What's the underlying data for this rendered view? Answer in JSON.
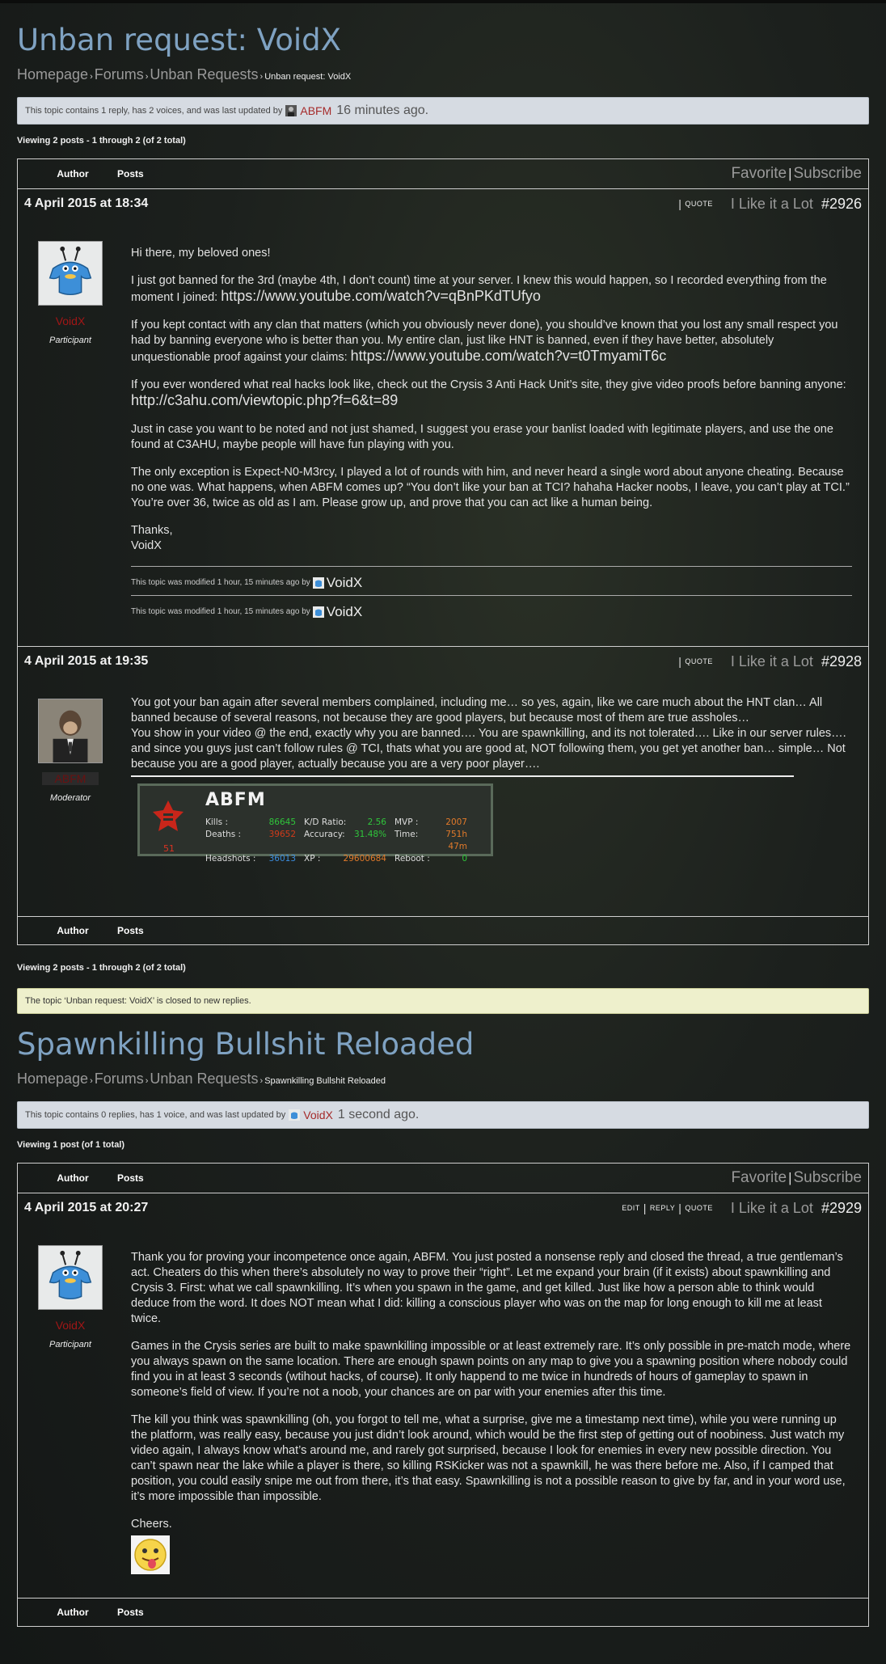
{
  "topic1": {
    "title": "Unban request: VoidX",
    "breadcrumb": {
      "home": "Homepage",
      "forums": "Forums",
      "section": "Unban Requests",
      "current": "Unban request: VoidX",
      "sep": "›"
    },
    "notice": {
      "text": "This topic contains 1 reply, has 2 voices, and was last updated by",
      "user": "ABFM",
      "time": "16 minutes ago."
    },
    "viewing_top": "Viewing 2 posts - 1 through 2 (of 2 total)",
    "header": {
      "author": "Author",
      "posts": "Posts",
      "favorite": "Favorite",
      "subscribe": "Subscribe"
    },
    "posts": [
      {
        "date": "4 April 2015 at 18:34",
        "quote": "QUOTE",
        "like": "I Like it a Lot",
        "id": "#2926",
        "author": "VoidX",
        "role": "Participant",
        "paragraphs": {
          "p1": "Hi there, my beloved ones!",
          "p2": "I just got banned for the 3rd (maybe 4th, I don’t count) time at your server. I knew this would happen, so I recorded everything from the moment I joined: ",
          "p2link": "https://www.youtube.com/watch?v=qBnPKdTUfyo",
          "p3": "If you kept contact with any clan that matters (which you obviously never done), you should’ve known that you lost any small respect you had by banning everyone who is better than you. My entire clan, just like HNT is banned, even if they have better, absolutely unquestionable proof against your claims: ",
          "p3link": "https://www.youtube.com/watch?v=t0TmyamiT6c",
          "p4": "If you ever wondered what real hacks look like, check out the Crysis 3 Anti Hack Unit’s site, they give video proofs before banning anyone: ",
          "p4link": "http://c3ahu.com/viewtopic.php?f=6&t=89",
          "p5": "Just in case you want to be noted and not just shamed, I suggest you erase your banlist loaded with legitimate players, and use the one found at C3AHU, maybe people will have fun playing with you.",
          "p6": "The only exception is Expect-N0-M3rcy, I played a lot of rounds with him, and never heard a single word about anyone cheating. Because no one was. What happens, when ABFM comes up? “You don’t like your ban at TCI? hahaha Hacker noobs, I leave, you can’t play at TCI.” You’re over 36, twice as old as I am. Please grow up, and prove that you can act like a human being.",
          "p7a": "Thanks,",
          "p7b": "VoidX"
        },
        "revision1": "This topic was modified 1 hour, 15 minutes ago by",
        "revision2": "This topic was modified 1 hour, 15 minutes ago by",
        "revision_user": "VoidX"
      },
      {
        "date": "4 April 2015 at 19:35",
        "quote": "QUOTE",
        "like": "I Like it a Lot",
        "id": "#2928",
        "author": "ABFM",
        "role": "Moderator",
        "p1": "You got your ban again after several members complained, including me… so yes, again, like we care much about the HNT clan… All banned because of several reasons, not because they are good players, but because most of them are true assholes…",
        "p2": "You show in your video @ the end, exactly why you are banned…. You are spawnkilling, and its not tolerated…. Like in our server rules…. and since you guys just can’t follow rules @ TCI, thats what you are good at, NOT following them, you get yet another ban… simple… Not because you are a good player, actually because you are a very poor player….",
        "signature": {
          "name": "ABFM",
          "level": "51",
          "kills_label": "Kills :",
          "kills": "86645",
          "deaths_label": "Deaths :",
          "deaths": "39652",
          "headshots_label": "Headshots :",
          "headshots": "36013",
          "kd_label": "K/D Ratio:",
          "kd": "2.56",
          "acc_label": "Accuracy:",
          "acc": "31.48%",
          "xp_label": "XP :",
          "xp": "29600684",
          "mvp_label": "MVP :",
          "mvp": "2007",
          "time_label": "Time:",
          "time": "751h 47m",
          "reboot_label": "Reboot :",
          "reboot": "0"
        }
      }
    ],
    "viewing_bottom": "Viewing 2 posts - 1 through 2 (of 2 total)",
    "closed": "The topic ‘Unban request: VoidX’ is closed to new replies."
  },
  "topic2": {
    "title": "Spawnkilling Bullshit Reloaded",
    "breadcrumb": {
      "home": "Homepage",
      "forums": "Forums",
      "section": "Unban Requests",
      "current": "Spawnkilling Bullshit Reloaded",
      "sep": "›"
    },
    "notice": {
      "text": "This topic contains 0 replies, has 1 voice, and was last updated by",
      "user": "VoidX",
      "time": "1 second ago."
    },
    "viewing_top": "Viewing 1 post (of 1 total)",
    "header": {
      "author": "Author",
      "posts": "Posts",
      "favorite": "Favorite",
      "subscribe": "Subscribe"
    },
    "post": {
      "date": "4 April 2015 at 20:27",
      "edit": "EDIT",
      "reply": "REPLY",
      "quote": "QUOTE",
      "like": "I Like it a Lot",
      "id": "#2929",
      "author": "VoidX",
      "role": "Participant",
      "p1": "Thank you for proving your incompetence once again, ABFM. You just posted a nonsense reply and closed the thread, a true gentleman’s act. Cheaters do this when there’s absolutely no way to prove their “right”. Let me expand your brain (if it exists) about spawnkilling and Crysis 3. First: what we call spawnkilling. It’s when you spawn in the game, and get killed. Just like how a person able to think would deduce from the word. It does NOT mean what I did: killing a conscious player who was on the map for long enough to kill me at least twice.",
      "p2": "Games in the Crysis series are built to make spawnkilling impossible or at least extremely rare. It’s only possible in pre-match mode, where you always spawn on the same location. There are enough spawn points on any map to give you a spawning position where nobody could find you in at least 3 seconds (wtihout hacks, of course). It only happend to me twice in hundreds of hours of gameplay to spawn in someone’s field of view. If you’re not a noob, your chances are on par with your enemies after this time.",
      "p3": "The kill you think was spawnkilling (oh, you forgot to tell me, what a surprise, give me a timestamp next time), while you were running up the platform, was really easy, because you just didn’t look around, which would be the first step of getting out of noobiness. Just watch my video again, I always know what’s around me, and rarely got surprised, because I look for enemies in every new possible direction. You can’t spawn near the lake while a player is there, so killing RSKicker was not a spawnkill, he was there before me. Also, if I camped that position, you could easily snipe me out from there, it’s that easy. Spawnkilling is not a possible reason to give by far, and in your word use, it’s more impossible than impossible.",
      "p4": "Cheers."
    },
    "footer": {
      "author": "Author",
      "posts": "Posts"
    }
  },
  "colors": {
    "title": "#7fa2c2",
    "author_name": "#a11616",
    "notice_bg": "#d6dbe2",
    "closed_bg": "#eef0cc"
  }
}
